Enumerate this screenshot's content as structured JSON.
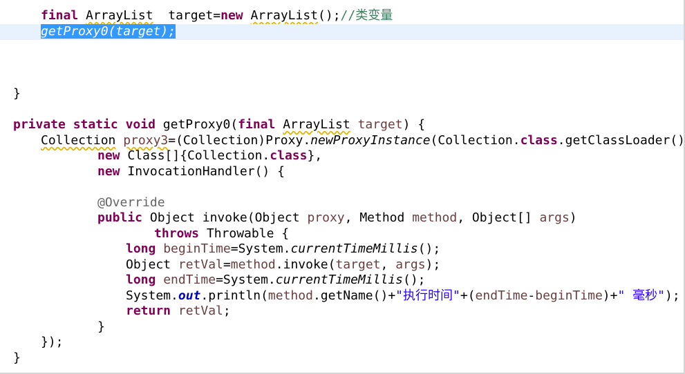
{
  "editor": {
    "language": "Java",
    "current_line_color": "#e8f2fe",
    "selection_color": "#3399ff",
    "lines": {
      "l1": {
        "kw_final": "final",
        "type": "ArrayList",
        "mid": "  target=",
        "kw_new": "new",
        "ctor": "ArrayList",
        "end": "();",
        "comment": "//类变量"
      },
      "l2": {
        "selected": "getProxy0(target);"
      },
      "l6": {
        "brace": "}"
      },
      "l8": {
        "kw_private": "private",
        "kw_static": "static",
        "kw_void": "void",
        "name": "getProxy0(",
        "kw_final": "final",
        "type": "ArrayList",
        "param": "target",
        "end": ") {"
      },
      "l9": {
        "type": "Collection",
        "var": "proxy3",
        "cast": "=(Collection)Proxy.",
        "method": "newProxyInstance",
        "mid": "(Collection.",
        "kw_class": "class",
        "end": ".getClassLoader(),"
      },
      "l10": {
        "kw_new": "new",
        "a": " Class[]{Collection.",
        "kw_class": "class",
        "b": "},"
      },
      "l11": {
        "kw_new": "new",
        "rest": " InvocationHandler() {"
      },
      "l13": {
        "annotation": "@Override"
      },
      "l14": {
        "kw_public": "public",
        "a": " Object invoke(Object ",
        "p1": "proxy",
        "b": ", Method ",
        "p2": "method",
        "c": ", Object[] ",
        "p3": "args",
        "d": ")"
      },
      "l15": {
        "kw_throws": "throws",
        "rest": " Throwable {"
      },
      "l16": {
        "kw_long": "long",
        "var": "beginTime",
        "a": "=System.",
        "method": "currentTimeMillis",
        "b": "();"
      },
      "l17": {
        "a": "Object ",
        "var": "retVal",
        "b": "=",
        "p_method": "method",
        "c": ".invoke(",
        "p_target": "target",
        "d": ", ",
        "p_args": "args",
        "e": ");"
      },
      "l18": {
        "kw_long": "long",
        "var": "endTime",
        "a": "=System.",
        "method": "currentTimeMillis",
        "b": "();"
      },
      "l19": {
        "a": "System.",
        "out": "out",
        "b": ".println(",
        "p_method": "method",
        "c": ".getName()+",
        "s1": "\"执行时间\"",
        "d": "+(",
        "v1": "endTime",
        "e": "-",
        "v2": "beginTime",
        "f": ")+",
        "s2": "\" 毫秒\"",
        "g": ");"
      },
      "l20": {
        "kw_return": "return",
        "var": "retVal",
        "end": ";"
      },
      "l21": {
        "brace": "}"
      },
      "l22": {
        "close": "});"
      },
      "l23": {
        "brace": "}"
      }
    }
  }
}
